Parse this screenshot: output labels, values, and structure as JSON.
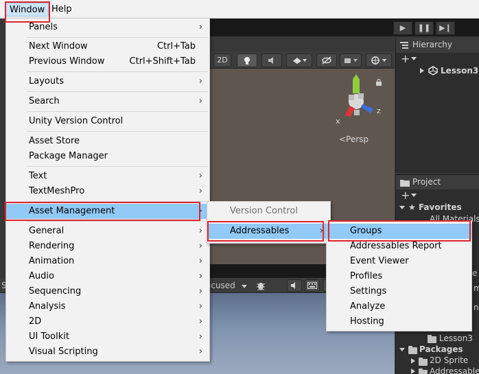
{
  "menubar": {
    "items": [
      "Window",
      "Help"
    ]
  },
  "scene_toolbar": {
    "mode_2d": "2D"
  },
  "scene_view": {
    "persp_label": "<Persp",
    "gizmo_axes": {
      "x": "x",
      "y": "y",
      "z": "z"
    }
  },
  "game_view": {
    "focused_label": "ocused",
    "left_letter": "S"
  },
  "hierarchy": {
    "tab": "Hierarchy",
    "add": "+",
    "scene_name": "Lesson3"
  },
  "project": {
    "tab": "Project",
    "add": "+",
    "favorites": "Favorites",
    "all_materials": "All Materials",
    "lesson3_folder": "Lesson3",
    "packages": "Packages",
    "sprite_2d": "2D Sprite",
    "addressables_pkg": "Addressables",
    "clipped_right_e": "e",
    "clipped_right_m": "m",
    "clipped_right_n": "n"
  },
  "window_menu": {
    "items": [
      {
        "label": "Panels",
        "submenu": true
      },
      {
        "label": "Next Window",
        "shortcut": "Ctrl+Tab"
      },
      {
        "label": "Previous Window",
        "shortcut": "Ctrl+Shift+Tab"
      },
      {
        "label": "Layouts",
        "submenu": true
      },
      {
        "label": "Search",
        "submenu": true
      },
      {
        "label": "Unity Version Control"
      },
      {
        "label": "Asset Store"
      },
      {
        "label": "Package Manager"
      },
      {
        "label": "Text",
        "submenu": true
      },
      {
        "label": "TextMeshPro",
        "submenu": true
      },
      {
        "label": "Asset Management",
        "submenu": true,
        "highlighted": true
      },
      {
        "label": "General",
        "submenu": true
      },
      {
        "label": "Rendering",
        "submenu": true
      },
      {
        "label": "Animation",
        "submenu": true
      },
      {
        "label": "Audio",
        "submenu": true
      },
      {
        "label": "Sequencing",
        "submenu": true
      },
      {
        "label": "Analysis",
        "submenu": true
      },
      {
        "label": "2D",
        "submenu": true
      },
      {
        "label": "UI Toolkit",
        "submenu": true
      },
      {
        "label": "Visual Scripting",
        "submenu": true
      }
    ]
  },
  "asset_management_menu": {
    "items": [
      {
        "label": "Version Control",
        "disabled": true
      },
      {
        "label": "Addressables",
        "submenu": true,
        "highlighted": true
      }
    ]
  },
  "addressables_menu": {
    "items": [
      {
        "label": "Groups",
        "highlighted": true
      },
      {
        "label": "Addressables Report"
      },
      {
        "label": "Event Viewer"
      },
      {
        "label": "Profiles"
      },
      {
        "label": "Settings"
      },
      {
        "label": "Analyze"
      },
      {
        "label": "Hosting"
      }
    ]
  },
  "colors": {
    "menu_bg": "#f2f2f2",
    "menu_highlight": "#91c9f7",
    "annotation_red": "#e0242e",
    "unity_dark": "#383838",
    "scene_bg": "#605650"
  }
}
